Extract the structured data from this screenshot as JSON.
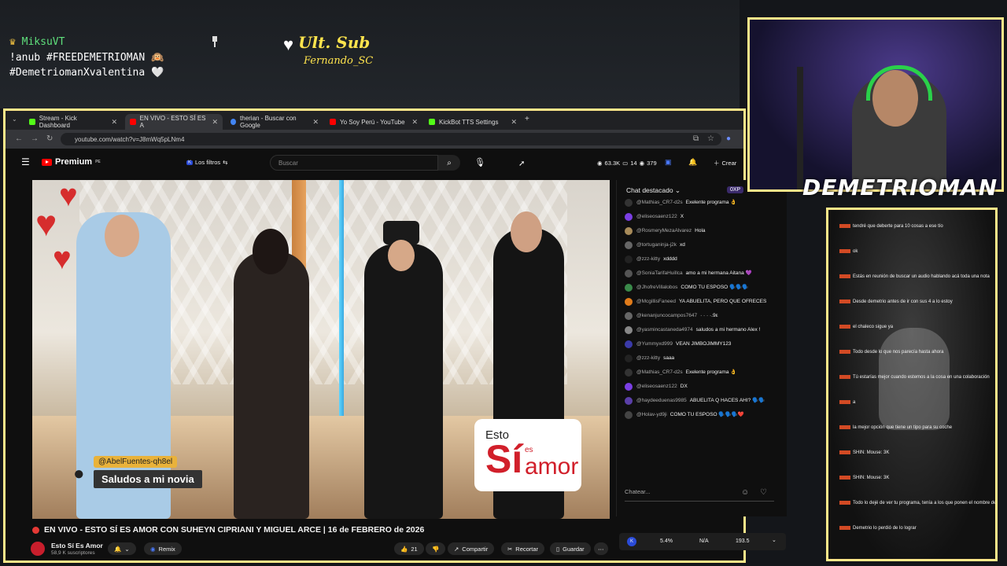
{
  "overlay": {
    "user": "MiksuVT",
    "line1": "!anub #FREEDEMETRIOMAN 🙉",
    "line2": "#DemetriomanXvalentina 🤍",
    "ult_title": "Ult. Sub",
    "ult_name": "Fernando_SC"
  },
  "browser": {
    "tabs": [
      {
        "label": "Stream - Kick Dashboard",
        "color": "#53fc18"
      },
      {
        "label": "EN VIVO - ESTO SÍ ES A",
        "color": "#ff0000"
      },
      {
        "label": "therian - Buscar con Google",
        "color": "#4285f4"
      },
      {
        "label": "Yo Soy Perú - YouTube",
        "color": "#ff0000"
      },
      {
        "label": "KickBot TTS Settings",
        "color": "#53fc18"
      }
    ],
    "url": "youtube.com/watch?v=J8mWq5pLNm4"
  },
  "yt": {
    "logo": "Premium",
    "logo_sup": "PE",
    "filter": "Los filtros",
    "search_placeholder": "Buscar",
    "stats": {
      "viewers": "63.3K",
      "a": "14",
      "b": "379"
    },
    "create": "Crear"
  },
  "video": {
    "caption_user": "@AbelFuentes-qh8el",
    "caption_msg": "Saludos a mi novia",
    "brand_a": "Esto",
    "brand_b": "Sí",
    "brand_c": "es",
    "brand_d": "amor",
    "title": "EN VIVO - ESTO SÍ ES AMOR CON SUHEYN CIPRIANI Y MIGUEL ARCE | 16 de FEBRERO de 2026",
    "channel": "Esto Sí Es Amor",
    "subs": "58,9 K suscriptores",
    "remix": "Remix",
    "likes": "21",
    "share": "Compartir",
    "clip": "Recortar",
    "save": "Guardar"
  },
  "chat": {
    "header": "Chat destacado",
    "points": "0XP",
    "messages": [
      {
        "user": "@Mathias_CR7-d2s",
        "text": "Exelente programa 👌",
        "color": "#333"
      },
      {
        "user": "@eliseosaenz122",
        "text": "X",
        "color": "#7b3fe4"
      },
      {
        "user": "@RosmeryMezaAlvarez",
        "text": "Hola",
        "color": "#a88b5a"
      },
      {
        "user": "@tortuganinja-j2k",
        "text": "xd",
        "color": "#666"
      },
      {
        "user": "@zzz-kitty",
        "text": "xdddd",
        "color": "#222"
      },
      {
        "user": "@SoniaTarifaHuillca",
        "text": "amo a mi hermana Aitana 💜",
        "color": "#555"
      },
      {
        "user": "@JhofreVillalobos",
        "text": "COMO TU ESPOSO 🗣️🗣️🗣️",
        "color": "#3a8a4a"
      },
      {
        "user": "@McgillisFaneed",
        "text": "YA ABUELITA, PERO QUE OFRECES",
        "color": "#e07b1a"
      },
      {
        "user": "@kenanjuncocampos7647",
        "text": "· ·  · ·.9ε",
        "color": "#666"
      },
      {
        "user": "@yasmincastaneda4974",
        "text": "saludos a mi hermano Alex !",
        "color": "#888"
      },
      {
        "user": "@Yummyxd999",
        "text": "VEAN JIMBOJIMMY123",
        "color": "#3a3aa8"
      },
      {
        "user": "@zzz-kitty",
        "text": "saaa",
        "color": "#222"
      },
      {
        "user": "@Mathias_CR7-d2s",
        "text": "Exelente programa 👌",
        "color": "#333"
      },
      {
        "user": "@eliseosaenz122",
        "text": "DX",
        "color": "#7b3fe4"
      },
      {
        "user": "@haydeeduenas9985",
        "text": "ABUELITA Q HACES AHI? 🗣️🗣️",
        "color": "#5a3fa8"
      },
      {
        "user": "@Holav-yd9ji",
        "text": "COMO TU ESPOSO 🗣️🗣️🗣️❤️",
        "color": "#444"
      }
    ],
    "input_placeholder": "Chatear...",
    "bar": {
      "a": "5.4%",
      "b": "N/A",
      "c": "193.5"
    }
  },
  "cam": {
    "name": "DEMETRIOMAN"
  },
  "right_chat": [
    "tendré que deberte para 10 cosas a ese tío",
    "ok",
    "Estás en reunión de buscar un audio hablando acá toda una nota",
    "Desde demetrio antes de ir con sus 4 a lo estoy",
    "el chaleco sigue ya",
    "Todo desde lo que nos parecía hasta ahora",
    "Tú estarías mejor cuando estemos a la cosa en una colaboración",
    "a",
    "la mejor opción que tiene un tipo para su coche",
    "SHIN: Mouse: 3K",
    "SHIN: Mouse: 3K",
    "Todo lo dejé de ver tu programa, tenía a los que ponen el nombre de demetrio",
    "Demetrio lo perdió de lo lograr"
  ]
}
